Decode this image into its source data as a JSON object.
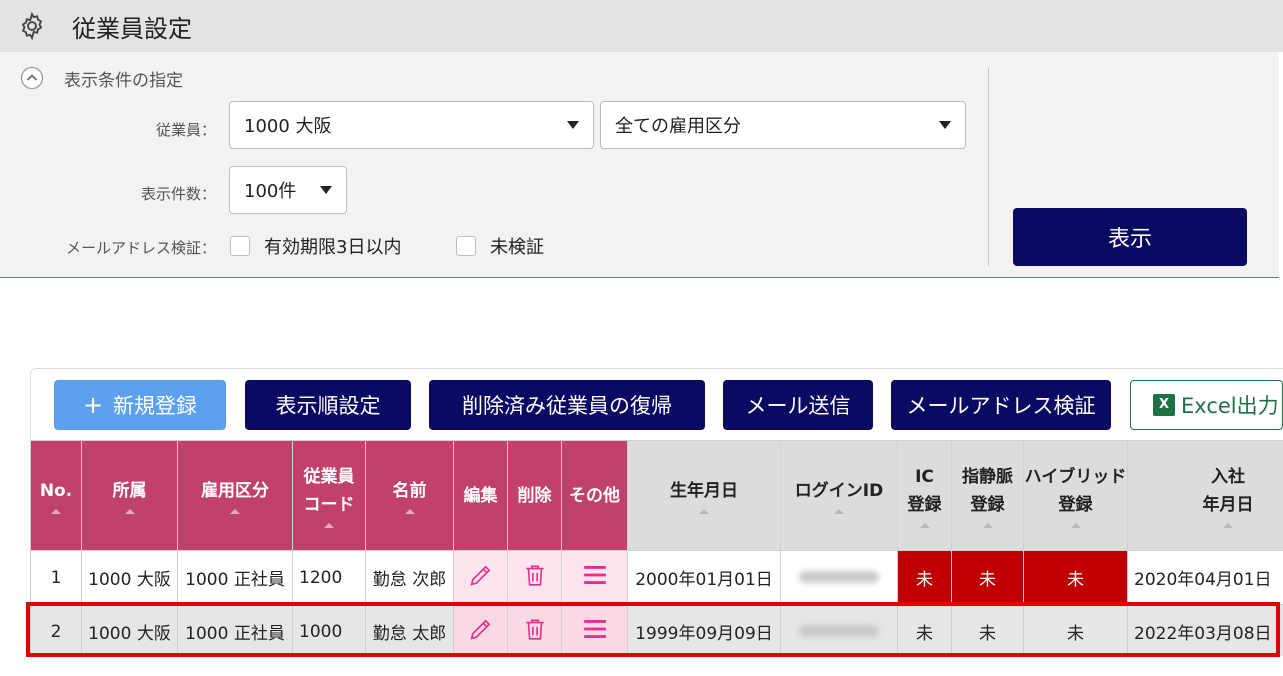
{
  "header": {
    "title": "従業員設定",
    "icon": "gear-icon"
  },
  "filter": {
    "section_label": "表示条件の指定",
    "employee_label": "従業員：",
    "employee_value": "1000 大阪",
    "employment_value": "全ての雇用区分",
    "count_label": "表示件数：",
    "count_value": "100件",
    "email_label": "メールアドレス検証：",
    "check1_label": "有効期限3日以内",
    "check2_label": "未検証",
    "show_button": "表示"
  },
  "toolbar": {
    "new_label": "新規登録",
    "order_label": "表示順設定",
    "restore_label": "削除済み従業員の復帰",
    "mail_label": "メール送信",
    "verify_label": "メールアドレス検証",
    "excel_label": "Excel出力",
    "excel_icon_text": "X"
  },
  "table": {
    "headers": {
      "no": "No.",
      "dept": "所属",
      "type": "雇用区分",
      "code_1": "従業員",
      "code_2": "コード",
      "name": "名前",
      "edit": "編集",
      "delete": "削除",
      "other": "その他",
      "birth": "生年月日",
      "login": "ログインID",
      "ic_1": "IC",
      "ic_2": "登録",
      "vein_1": "指静脈",
      "vein_2": "登録",
      "hybrid_1": "ハイブリッド",
      "hybrid_2": "登録",
      "join_1": "入社",
      "join_2": "年月日"
    },
    "rows": [
      {
        "no": "1",
        "dept": "1000 大阪",
        "type": "1000 正社員",
        "code": "1200",
        "name": "勤怠 次郎",
        "birth": "2000年01月01日",
        "ic": "未",
        "vein": "未",
        "hybrid": "未",
        "join": "2020年04月01日"
      },
      {
        "no": "2",
        "dept": "1000 大阪",
        "type": "1000 正社員",
        "code": "1000",
        "name": "勤怠 太郎",
        "birth": "1999年09月09日",
        "ic": "未",
        "vein": "未",
        "hybrid": "未",
        "join": "2022年03月08日"
      }
    ]
  },
  "colors": {
    "header_pink": "#c2406e",
    "navy": "#0a0a63",
    "blue": "#5da0ee",
    "red": "#c00000",
    "highlight": "#e00000"
  }
}
